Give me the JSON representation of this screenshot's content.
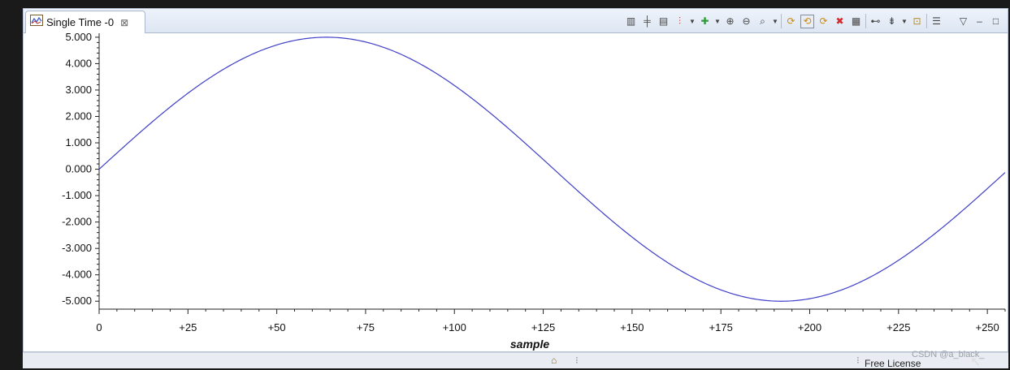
{
  "tab": {
    "title": "Single Time -0",
    "close_glyph": "⊠",
    "icon": "line-chart-icon"
  },
  "toolbar": {
    "icons": [
      "align-icon",
      "split-icon",
      "table-icon",
      "marker-icon",
      "dropdown",
      "add-icon",
      "dropdown",
      "zoom-in-icon",
      "zoom-out-icon",
      "zoom-rect-icon",
      "dropdown",
      "separator",
      "refresh-icon",
      "auto-refresh-icon",
      "refresh-all-icon",
      "clear-icon",
      "data-icon",
      "separator",
      "binoculars-icon",
      "pin-icon",
      "dropdown",
      "lock-icon",
      "separator",
      "properties-icon"
    ],
    "view_menu": "▽",
    "minimize": "–",
    "maximize": "□"
  },
  "chart_data": {
    "type": "line",
    "series": [
      {
        "color": "#3f3fc8",
        "amplitude": 5,
        "period": 256,
        "x_start": 0,
        "x_end": 255,
        "function": "5*sin(2*pi*x/256)"
      }
    ],
    "xlabel": "sample",
    "ylabel": "",
    "xlim": [
      0,
      255
    ],
    "ylim": [
      -5.3,
      5.15
    ],
    "x_ticks": [
      0,
      25,
      50,
      75,
      100,
      125,
      150,
      175,
      200,
      225,
      250
    ],
    "x_tick_labels": [
      "0",
      "+25",
      "+50",
      "+75",
      "+100",
      "+125",
      "+150",
      "+175",
      "+200",
      "+225",
      "+250"
    ],
    "y_ticks": [
      5,
      4,
      3,
      2,
      1,
      0,
      -1,
      -2,
      -3,
      -4,
      -5
    ],
    "y_tick_labels": [
      "5.000",
      "4.000",
      "3.000",
      "2.000",
      "1.000",
      "0.000",
      "-1.000",
      "-2.000",
      "-3.000",
      "-4.000",
      "-5.000"
    ],
    "grid": false
  },
  "statusbar": {
    "license": "Free License",
    "watermark": "CSDN @a_black_"
  }
}
